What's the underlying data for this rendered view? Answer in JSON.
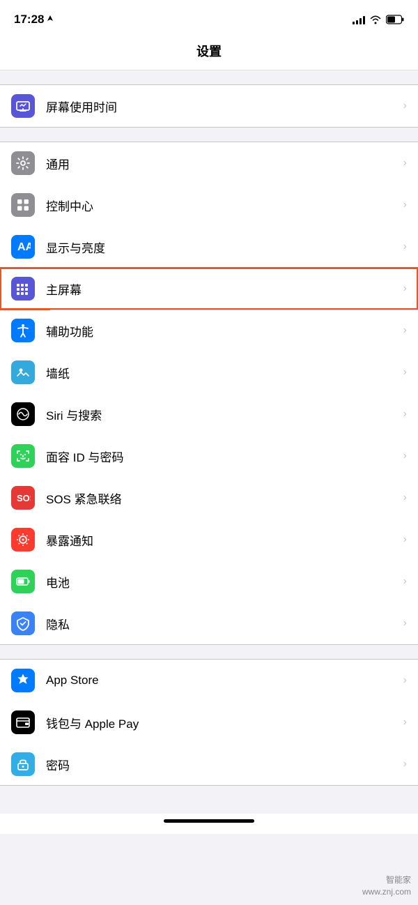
{
  "statusBar": {
    "time": "17:28",
    "locationIcon": "›",
    "signalBars": [
      4,
      6,
      8,
      10,
      12
    ],
    "wifiIcon": "wifi",
    "batteryIcon": "battery"
  },
  "pageTitle": "设置",
  "groups": [
    {
      "id": "group1",
      "items": [
        {
          "id": "screen-time",
          "icon": "screen-time-icon",
          "iconBg": "icon-screen-time",
          "label": "屏幕使用时间",
          "chevron": "›",
          "highlighted": false
        }
      ]
    },
    {
      "id": "group2",
      "items": [
        {
          "id": "general",
          "icon": "gear-icon",
          "iconBg": "icon-general",
          "label": "通用",
          "chevron": "›",
          "highlighted": false
        },
        {
          "id": "control-center",
          "icon": "control-center-icon",
          "iconBg": "icon-control-center",
          "label": "控制中心",
          "chevron": "›",
          "highlighted": false
        },
        {
          "id": "display",
          "icon": "display-icon",
          "iconBg": "icon-display",
          "label": "显示与亮度",
          "chevron": "›",
          "highlighted": false
        },
        {
          "id": "home-screen",
          "icon": "home-screen-icon",
          "iconBg": "icon-home-screen",
          "label": "主屏幕",
          "chevron": "›",
          "highlighted": true
        },
        {
          "id": "accessibility",
          "icon": "accessibility-icon",
          "iconBg": "icon-accessibility",
          "label": "辅助功能",
          "chevron": "›",
          "highlighted": false
        },
        {
          "id": "wallpaper",
          "icon": "wallpaper-icon",
          "iconBg": "icon-wallpaper",
          "label": "墙纸",
          "chevron": "›",
          "highlighted": false
        },
        {
          "id": "siri",
          "icon": "siri-icon",
          "iconBg": "icon-siri",
          "label": "Siri 与搜索",
          "chevron": "›",
          "highlighted": false
        },
        {
          "id": "face-id",
          "icon": "face-id-icon",
          "iconBg": "icon-face-id",
          "label": "面容 ID 与密码",
          "chevron": "›",
          "highlighted": false
        },
        {
          "id": "sos",
          "icon": "sos-icon",
          "iconBg": "icon-sos",
          "label": "SOS 紧急联络",
          "chevron": "›",
          "highlighted": false
        },
        {
          "id": "exposure",
          "icon": "exposure-icon",
          "iconBg": "icon-exposure",
          "label": "暴露通知",
          "chevron": "›",
          "highlighted": false
        },
        {
          "id": "battery",
          "icon": "battery-icon",
          "iconBg": "icon-battery",
          "label": "电池",
          "chevron": "›",
          "highlighted": false
        },
        {
          "id": "privacy",
          "icon": "privacy-icon",
          "iconBg": "icon-privacy",
          "label": "隐私",
          "chevron": "›",
          "highlighted": false
        }
      ]
    },
    {
      "id": "group3",
      "items": [
        {
          "id": "app-store",
          "icon": "appstore-icon",
          "iconBg": "icon-appstore",
          "label": "App Store",
          "chevron": "›",
          "highlighted": false
        },
        {
          "id": "wallet",
          "icon": "wallet-icon",
          "iconBg": "icon-wallet",
          "label": "钱包与 Apple Pay",
          "chevron": "›",
          "highlighted": false
        },
        {
          "id": "password",
          "icon": "password-icon",
          "iconBg": "icon-password",
          "label": "密码",
          "chevron": "›",
          "highlighted": false
        }
      ]
    }
  ],
  "watermark": {
    "line1": "智能家",
    "line2": "www.znj.com"
  },
  "bottomBar": {
    "indicator": "─"
  }
}
